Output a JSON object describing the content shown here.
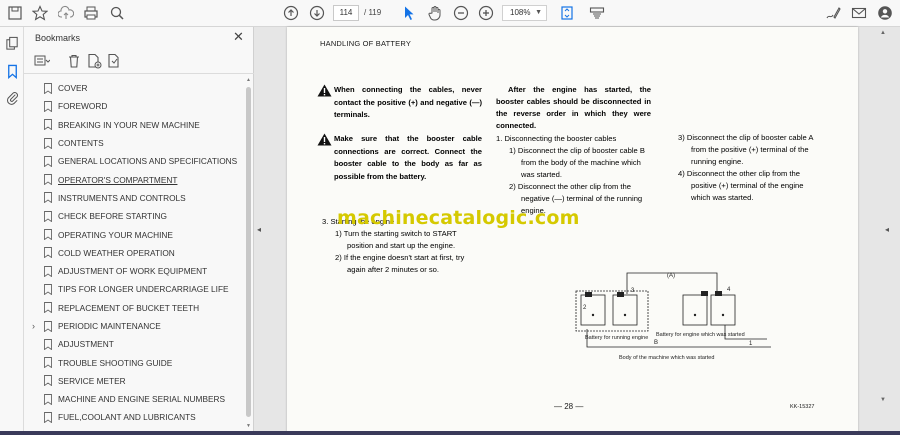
{
  "toolbar": {
    "page_current": "114",
    "page_total": "/ 119",
    "zoom": "108%",
    "icons": [
      "save-icon",
      "star-icon",
      "upload-icon",
      "print-icon",
      "zoom-search-icon",
      "page-up-icon",
      "page-down-icon",
      "cursor-icon",
      "hand-icon",
      "zoom-out-icon",
      "zoom-in-icon",
      "zoom-dropdown",
      "fit-page-icon",
      "annotate-icon",
      "sign-icon",
      "email-icon",
      "profile-icon"
    ]
  },
  "panel": {
    "title": "Bookmarks",
    "items": [
      {
        "label": "COVER",
        "expandable": false,
        "underlined": false
      },
      {
        "label": "FOREWORD",
        "expandable": false,
        "underlined": false
      },
      {
        "label": "BREAKING IN YOUR NEW MACHINE",
        "expandable": false,
        "underlined": false
      },
      {
        "label": "CONTENTS",
        "expandable": false,
        "underlined": false
      },
      {
        "label": "GENERAL LOCATIONS AND SPECIFICATIONS",
        "expandable": false,
        "underlined": false
      },
      {
        "label": "OPERATOR'S COMPARTMENT",
        "expandable": false,
        "underlined": true
      },
      {
        "label": "INSTRUMENTS AND CONTROLS",
        "expandable": false,
        "underlined": false
      },
      {
        "label": "CHECK BEFORE STARTING",
        "expandable": false,
        "underlined": false
      },
      {
        "label": "OPERATING YOUR MACHINE",
        "expandable": false,
        "underlined": false
      },
      {
        "label": "COLD WEATHER OPERATION",
        "expandable": false,
        "underlined": false
      },
      {
        "label": "ADJUSTMENT OF WORK EQUIPMENT",
        "expandable": false,
        "underlined": false
      },
      {
        "label": "TIPS FOR LONGER UNDERCARRIAGE LIFE",
        "expandable": false,
        "underlined": false
      },
      {
        "label": "REPLACEMENT OF BUCKET TEETH",
        "expandable": false,
        "underlined": false
      },
      {
        "label": "PERIODIC MAINTENANCE",
        "expandable": true,
        "underlined": false
      },
      {
        "label": "ADJUSTMENT",
        "expandable": false,
        "underlined": false
      },
      {
        "label": "TROUBLE SHOOTING GUIDE",
        "expandable": false,
        "underlined": false
      },
      {
        "label": "SERVICE METER",
        "expandable": false,
        "underlined": false
      },
      {
        "label": "MACHINE AND ENGINE SERIAL NUMBERS",
        "expandable": false,
        "underlined": false
      },
      {
        "label": "FUEL,COOLANT AND LUBRICANTS",
        "expandable": false,
        "underlined": false
      }
    ]
  },
  "document": {
    "heading": "HANDLING OF BATTERY",
    "warning1": "When connecting the cables, never contact the positive (+) and negative (—) terminals.",
    "warning2": "Make sure that the booster cable connections are correct. Connect the booster cable to the body as far as possible from the battery.",
    "col2_intro": "After the engine has started, the booster cables should be disconnected in the reverse order in which they were connected.",
    "col2_step1": "1.  Disconnecting the booster cables",
    "col2_sub1": "1)  Disconnect the clip of booster cable B from the body of the machine which was started.",
    "col2_sub2": "2)  Disconnect the other clip from the negative (—) terminal of the running engine.",
    "col3_sub3": "3)  Disconnect the clip of booster cable A from the positive (+) terminal of the running engine.",
    "col3_sub4": "4)  Disconnect the other clip from the positive (+) terminal of the engine which was started.",
    "step3_title": "3.  Starting the engine",
    "step3_sub1": "1)  Turn the starting switch to START position and start up the engine.",
    "step3_sub2": "2)  If the engine doesn't start at first, try again after 2 minutes or so.",
    "watermark": "machinecatalogic.com",
    "diagram_label_a": "(A)",
    "diagram_label_b": "B",
    "diagram_battery_running": "Battery for running engine",
    "diagram_battery_started": "Battery for engine which was started",
    "diagram_body": "Body of the machine which was started",
    "diagram_nums": [
      "1",
      "2",
      "3",
      "4"
    ],
    "page_number": "— 28 —",
    "doc_code": "KK-15327"
  },
  "colors": {
    "watermark": "#d5c900",
    "accent": "#1473e6"
  }
}
